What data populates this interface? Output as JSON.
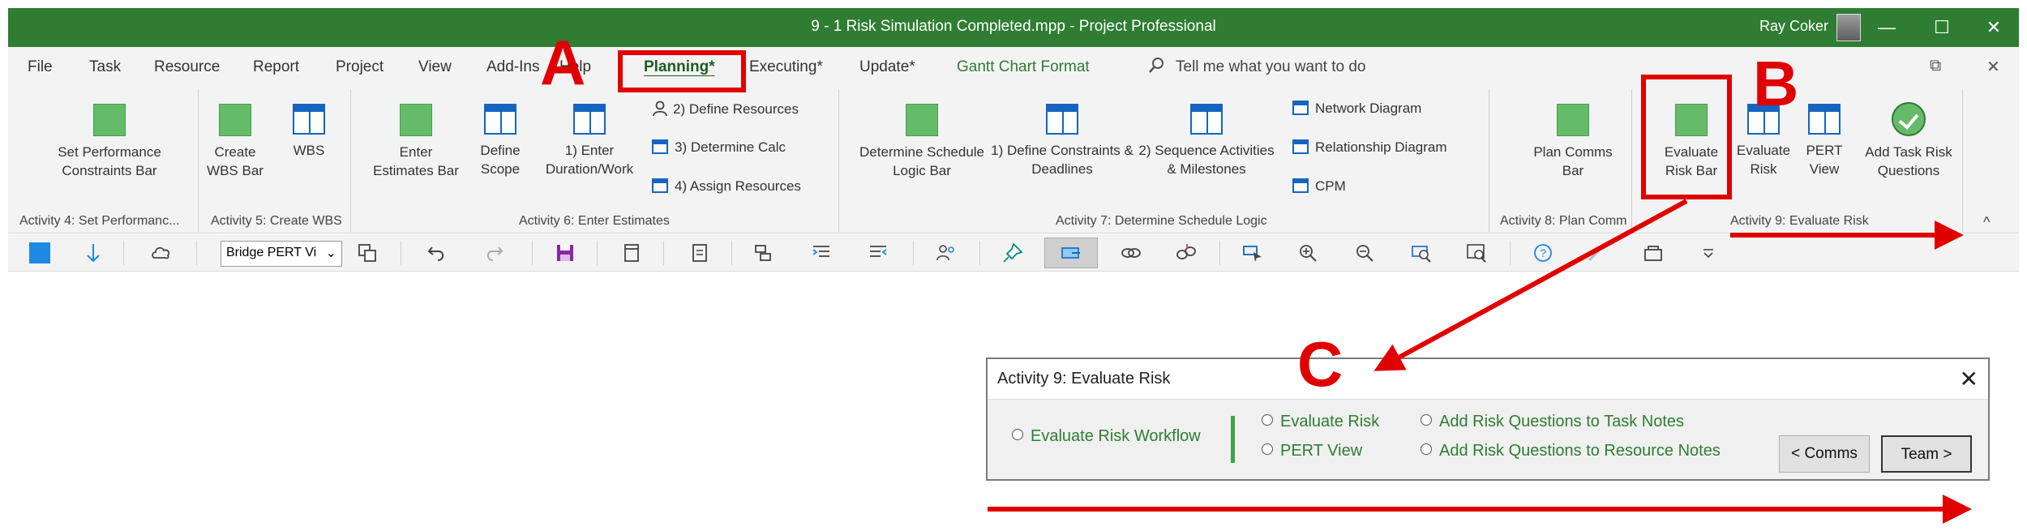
{
  "window": {
    "title": "9 - 1 Risk Simulation Completed.mpp  -  Project Professional",
    "user": "Ray Coker",
    "minimize_glyph": "—",
    "restore_glyph": "☐",
    "close_glyph": "✕"
  },
  "tabs": {
    "file": "File",
    "task": "Task",
    "resource": "Resource",
    "report": "Report",
    "project": "Project",
    "view": "View",
    "addins": "Add-Ins",
    "help": "Help",
    "planning": "Planning*",
    "executing": "Executing*",
    "update": "Update*",
    "gantt": "Gantt Chart Format",
    "tell_me": "Tell me what you want to do",
    "ribbon_restore": "⧉",
    "ribbon_close": "✕"
  },
  "ribbon": {
    "set_perf": "Set Performance Constraints Bar",
    "create_wbs_bar": "Create WBS Bar",
    "wbs": "WBS",
    "enter_estimates_bar": "Enter Estimates Bar",
    "define_scope": "Define Scope",
    "enter_duration": "1) Enter Duration/Work",
    "define_resources": "2) Define Resources",
    "determine_calc": "3) Determine Calc",
    "assign_resources": "4) Assign Resources",
    "determine_schedule_logic_bar": "Determine Schedule Logic Bar",
    "define_constraints": "1) Define Constraints & Deadlines",
    "sequence_activities": "2) Sequence Activities & Milestones",
    "network_diagram": "Network Diagram",
    "relationship_diagram": "Relationship Diagram",
    "cpm": "CPM",
    "plan_comms_bar": "Plan Comms Bar",
    "evaluate_risk_bar": "Evaluate Risk Bar",
    "evaluate_risk": "Evaluate Risk",
    "pert_view": "PERT View",
    "add_task_risk_questions": "Add Task Risk Questions",
    "groups": {
      "g4": "Activity 4: Set Performanc...",
      "g5": "Activity 5: Create WBS",
      "g6": "Activity 6: Enter Estimates",
      "g7": "Activity 7: Determine Schedule Logic",
      "g8": "Activity 8: Plan Comm",
      "g9": "Activity 9: Evaluate Risk"
    },
    "collapse_glyph": "^"
  },
  "qat": {
    "view_select": "Bridge PERT Vi",
    "dropdown_glyph": "⌄"
  },
  "dialog": {
    "title": "Activity 9: Evaluate Risk",
    "close_glyph": "✕",
    "workflow": "Evaluate Risk Workflow",
    "evaluate_risk": "Evaluate Risk",
    "pert_view": "PERT View",
    "add_task_notes": "Add Risk Questions to Task Notes",
    "add_resource_notes": "Add Risk Questions to Resource Notes",
    "comms_button": "< Comms",
    "team_button": "Team >"
  },
  "annotations": {
    "a": "A",
    "b": "B",
    "c": "C",
    "color": "#e10000"
  },
  "colors": {
    "title_bar": "#2e7d32",
    "accent_green": "#66bb6a",
    "icon_blue": "#1565c0"
  }
}
